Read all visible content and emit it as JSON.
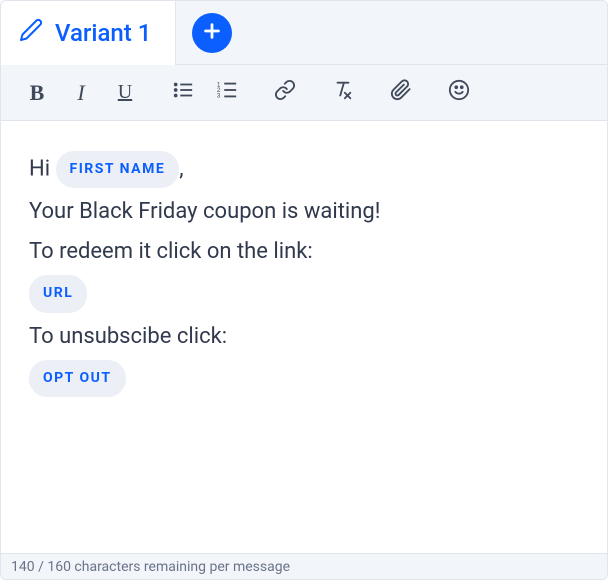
{
  "tabs": {
    "active": {
      "label": "Variant 1"
    }
  },
  "toolbar": {
    "bold": "B",
    "italic": "I",
    "underline": "U"
  },
  "content": {
    "line1_prefix": "Hi ",
    "line1_suffix": ",",
    "chip1": "First Name",
    "line2": "Your Black Friday coupon is waiting!",
    "line3": "To redeem it click on the link:",
    "chip2": "URL",
    "line4": "To unsubscibe click:",
    "chip3": "Opt Out"
  },
  "footer": {
    "counter": "140 / 160",
    "hint": "characters remaining per message"
  }
}
